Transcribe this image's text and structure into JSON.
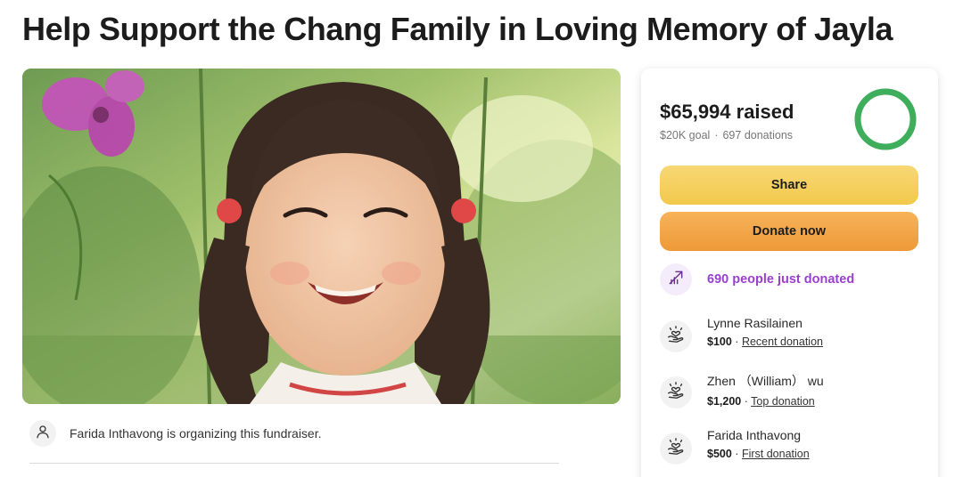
{
  "page": {
    "title": "Help Support the Chang Family in Loving Memory of Jayla"
  },
  "organizer": {
    "text": "Farida Inthavong is organizing this fundraiser."
  },
  "donation_card": {
    "raised": "$65,994 raised",
    "goal": "$20K goal",
    "separator": "·",
    "donations_count": "697 donations",
    "progress_fraction": 1.0,
    "share_label": "Share",
    "donate_label": "Donate now",
    "recent_activity": "690 people just donated",
    "donors": [
      {
        "name": "Lynne Rasilainen",
        "amount": "$100",
        "separator": "·",
        "tag": "Recent donation"
      },
      {
        "name": "Zhen （William） wu",
        "amount": "$1,200",
        "separator": "·",
        "tag": "Top donation"
      },
      {
        "name": "Farida Inthavong",
        "amount": "$500",
        "separator": "·",
        "tag": "First donation"
      }
    ]
  },
  "colors": {
    "accent_green": "#3fae5c",
    "share_yellow": "#f2c94c",
    "donate_orange": "#ee9a38",
    "trend_purple": "#9b3fd1"
  },
  "icons": {
    "organizer": "user-icon",
    "trend": "trending-up-icon",
    "donor": "heart-hand-icon"
  }
}
